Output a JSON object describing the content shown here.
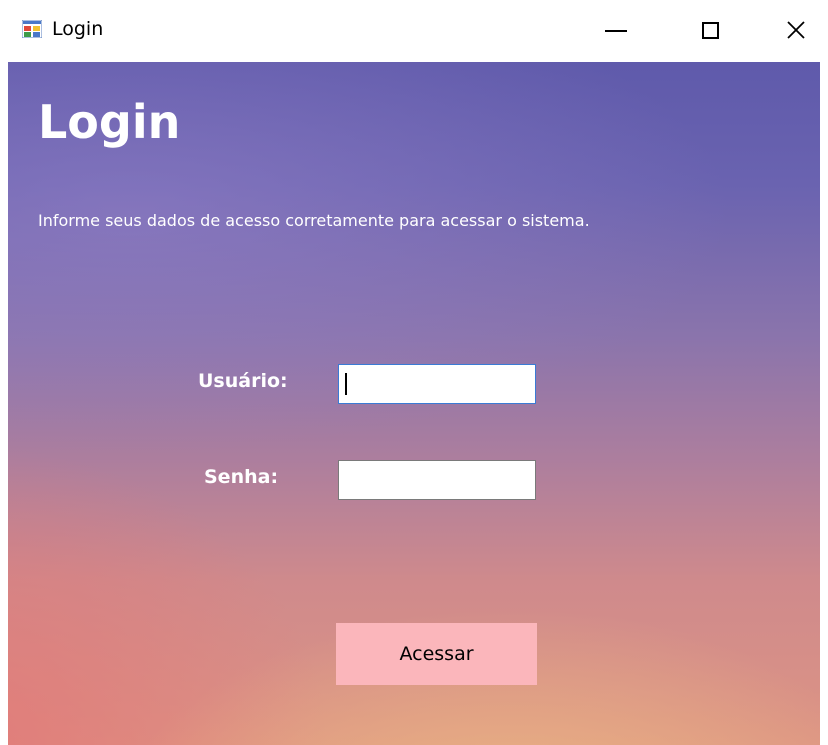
{
  "window": {
    "title": "Login",
    "icon": "winforms-app-icon",
    "controls": [
      "minimize-icon",
      "maximize-icon",
      "close-icon"
    ]
  },
  "form": {
    "heading": "Login",
    "subtitle": "Informe seus dados de acesso corretamente para acessar o sistema.",
    "username_label": "Usuário:",
    "username_value": "",
    "password_label": "Senha:",
    "password_value": "",
    "submit_label": "Acessar"
  },
  "colors": {
    "gradient_top": "#5f5aab",
    "gradient_bottom": "#dd9484",
    "button_background": "#fbb6bb",
    "focused_input_border": "#3a7bd5"
  }
}
